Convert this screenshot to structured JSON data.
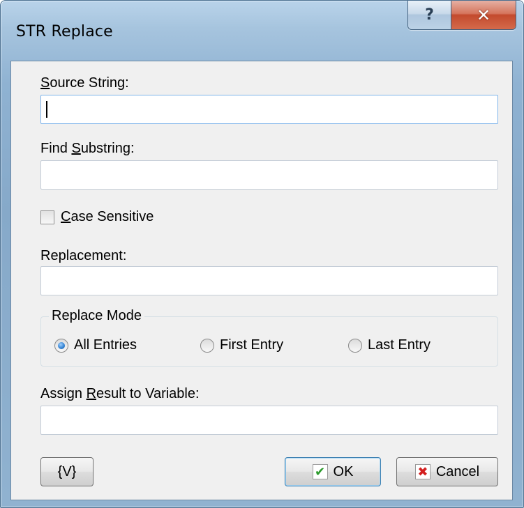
{
  "window": {
    "title": "STR Replace",
    "help_glyph": "?",
    "close_glyph": "✕"
  },
  "source_string": {
    "label_accel": "S",
    "label_rest": "ource String:",
    "value": ""
  },
  "find_substring": {
    "label_pre": "Find ",
    "label_accel": "S",
    "label_rest": "ubstring:",
    "value": ""
  },
  "case_sensitive": {
    "label_accel": "C",
    "label_rest": "ase Sensitive",
    "checked": false
  },
  "replacement": {
    "label": "Replacement:",
    "value": ""
  },
  "replace_mode": {
    "title": "Replace Mode",
    "options": [
      {
        "label": "All Entries",
        "selected": true
      },
      {
        "label": "First Entry",
        "selected": false
      },
      {
        "label": "Last Entry",
        "selected": false
      }
    ]
  },
  "assign_result": {
    "label_pre": "Assign ",
    "label_accel": "R",
    "label_rest": "esult to Variable:",
    "value": ""
  },
  "buttons": {
    "variables_label": "{V}",
    "ok_label": "OK",
    "ok_icon": "check-icon",
    "ok_glyph": "✔",
    "cancel_label": "Cancel",
    "cancel_icon": "x-icon",
    "cancel_glyph": "✖"
  }
}
